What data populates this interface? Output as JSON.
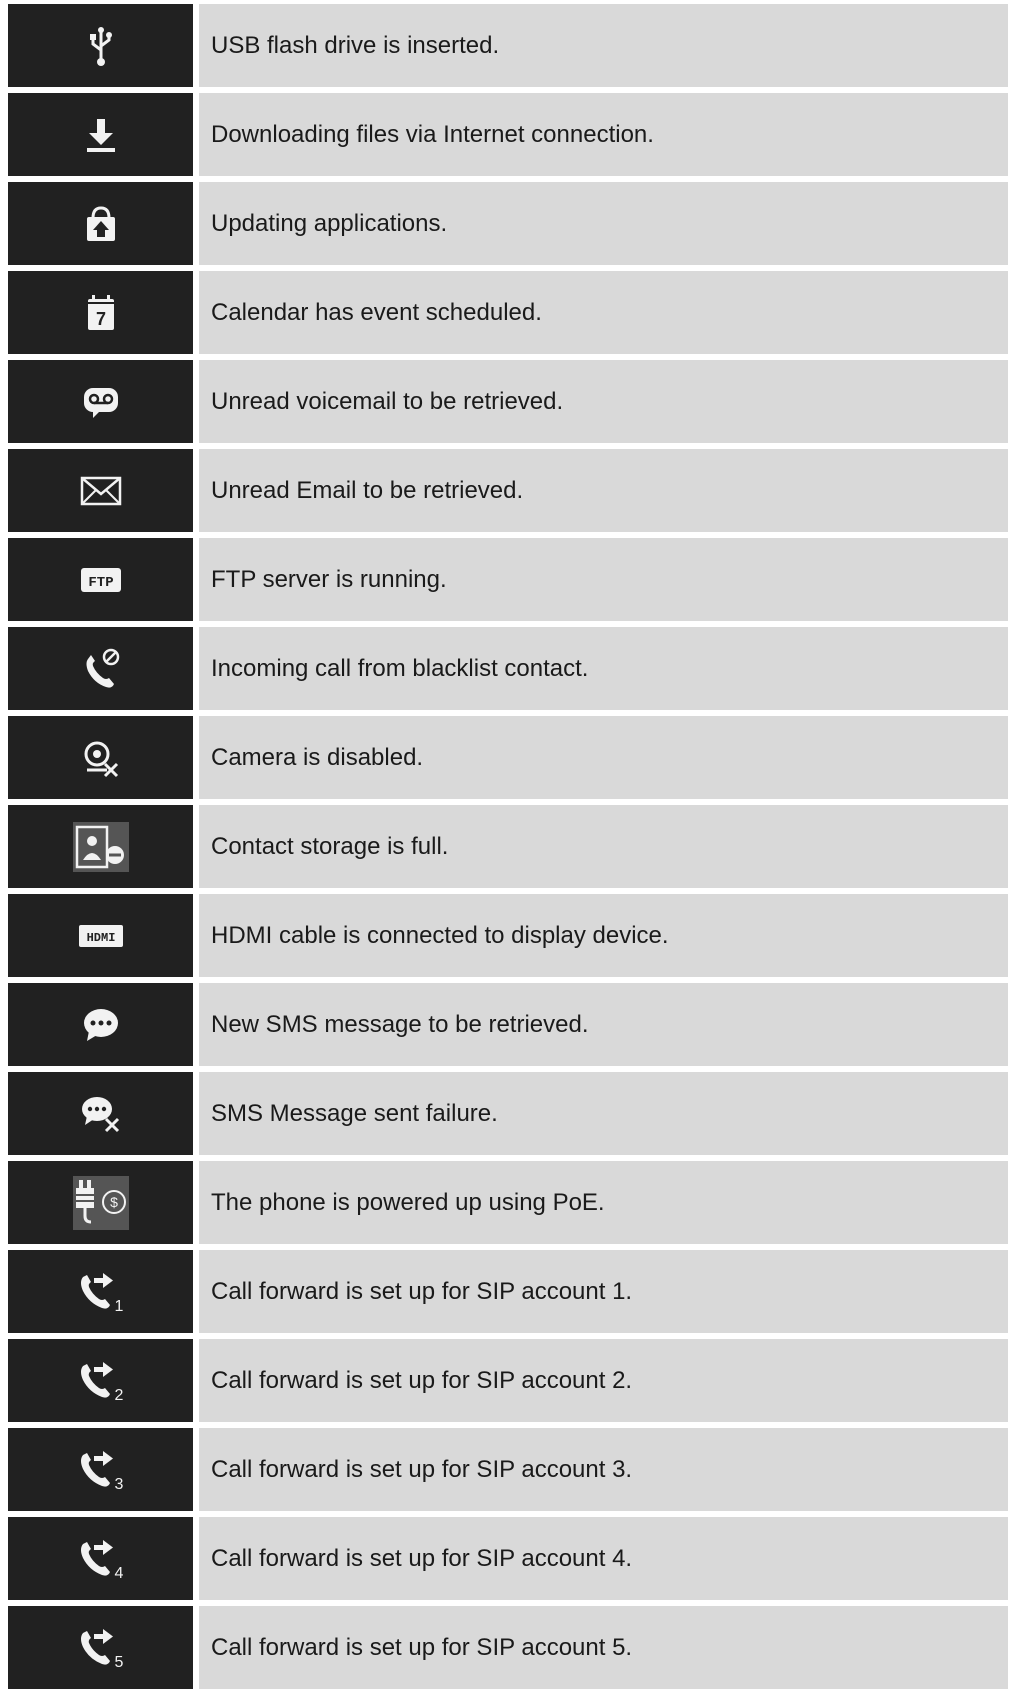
{
  "colors": {
    "icon_bg": "#212121",
    "row_bg": "#d9d9d9",
    "icon_fg": "#f2f2f2"
  },
  "rows": [
    {
      "icon": "usb-icon",
      "text": "USB flash drive is inserted."
    },
    {
      "icon": "download-icon",
      "text": "Downloading files via Internet connection."
    },
    {
      "icon": "app-update-icon",
      "text": "Updating applications."
    },
    {
      "icon": "calendar-icon",
      "text": "Calendar has event scheduled.",
      "icon_label": "7"
    },
    {
      "icon": "voicemail-icon",
      "text": "Unread voicemail to be retrieved."
    },
    {
      "icon": "email-icon",
      "text": "Unread Email to be retrieved."
    },
    {
      "icon": "ftp-icon",
      "text": "FTP server is running.",
      "icon_label": "FTP"
    },
    {
      "icon": "blacklist-call-icon",
      "text": "Incoming call from blacklist contact."
    },
    {
      "icon": "camera-disabled-icon",
      "text": "Camera is disabled."
    },
    {
      "icon": "contact-full-icon",
      "text": "Contact storage is full."
    },
    {
      "icon": "hdmi-icon",
      "text": "HDMI cable is connected to display device.",
      "icon_label": "HDMI"
    },
    {
      "icon": "sms-icon",
      "text": "New SMS message to be retrieved."
    },
    {
      "icon": "sms-failed-icon",
      "text": "SMS Message sent failure."
    },
    {
      "icon": "poe-icon",
      "text": "The phone is powered up using PoE."
    },
    {
      "icon": "call-forward-icon",
      "text": "Call forward is set up for SIP account 1.",
      "icon_label": "1"
    },
    {
      "icon": "call-forward-icon",
      "text": "Call forward is set up for SIP account 2.",
      "icon_label": "2"
    },
    {
      "icon": "call-forward-icon",
      "text": "Call forward is set up for SIP account 3.",
      "icon_label": "3"
    },
    {
      "icon": "call-forward-icon",
      "text": "Call forward is set up for SIP account 4.",
      "icon_label": "4"
    },
    {
      "icon": "call-forward-icon",
      "text": "Call forward is set up for SIP account 5.",
      "icon_label": "5"
    }
  ]
}
